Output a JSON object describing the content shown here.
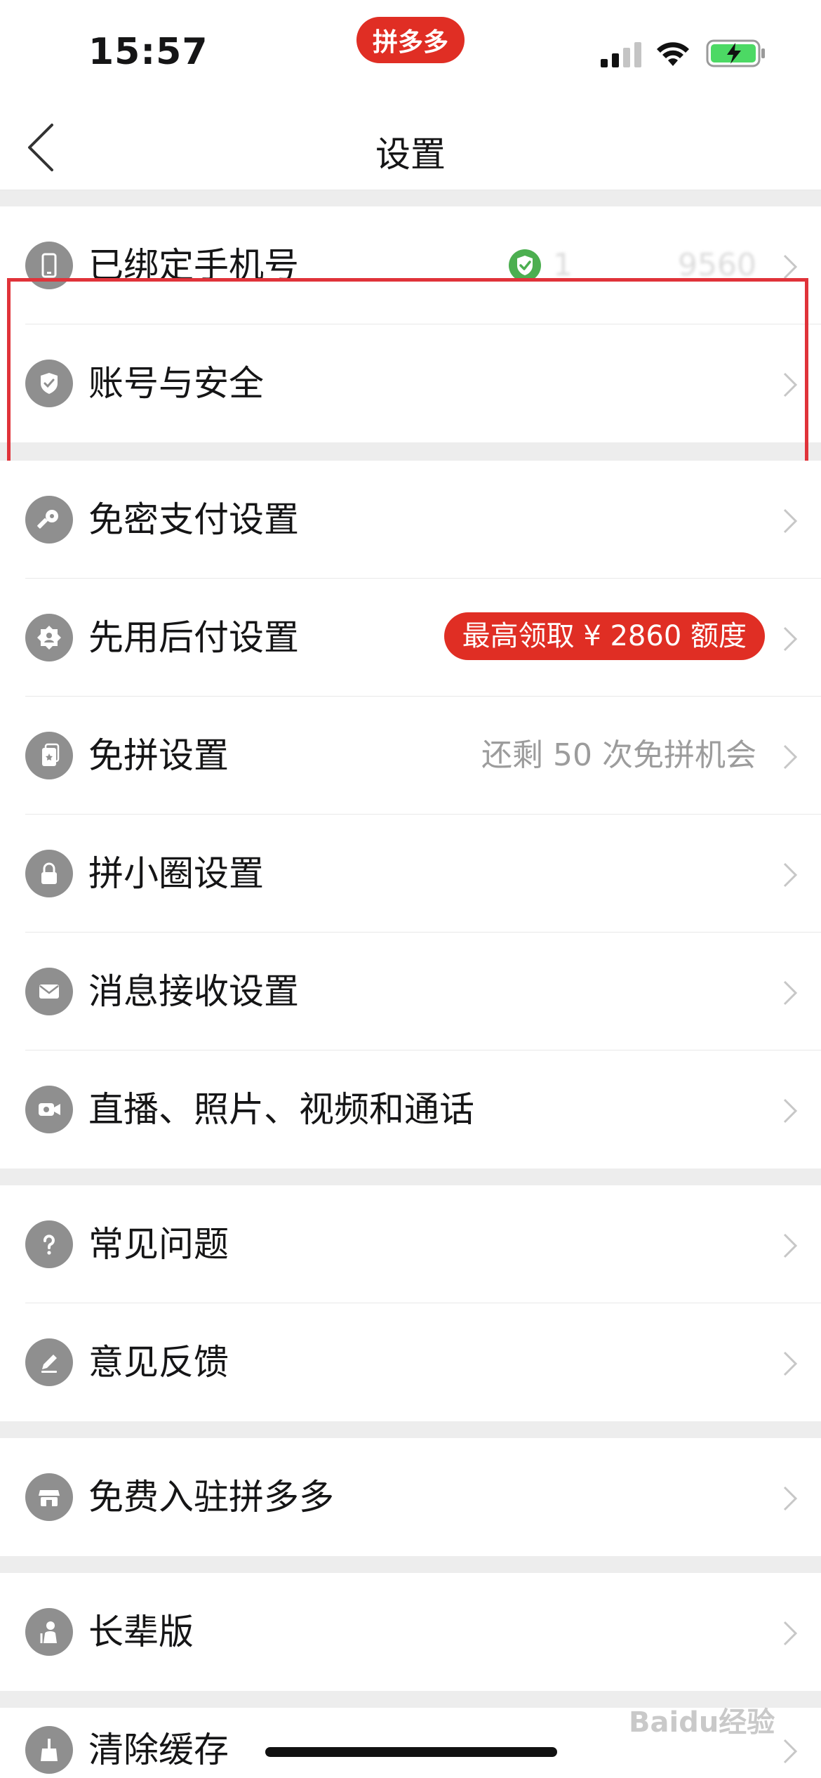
{
  "status_bar": {
    "time": "15:57",
    "app_badge": "拼多多"
  },
  "nav": {
    "title": "设置"
  },
  "phone_row": {
    "label": "已绑定手机号",
    "masked_phone_start": "1",
    "masked_phone_end": "9560"
  },
  "account_row": {
    "label": "账号与安全"
  },
  "settings_group": [
    {
      "label": "免密支付设置"
    },
    {
      "label": "先用后付设置",
      "promo": "最高领取 ¥ 2860 额度"
    },
    {
      "label": "免拼设置",
      "right_text": "还剩 50 次免拼机会"
    },
    {
      "label": "拼小圈设置"
    },
    {
      "label": "消息接收设置"
    },
    {
      "label": "直播、照片、视频和通话"
    }
  ],
  "help_group": [
    {
      "label": "常见问题"
    },
    {
      "label": "意见反馈"
    }
  ],
  "merchant_row": {
    "label": "免费入驻拼多多"
  },
  "elder_row": {
    "label": "长辈版"
  },
  "cache_row": {
    "label": "清除缓存"
  },
  "watermark": "Baidu经验",
  "colors": {
    "accent": "#e02e24",
    "highlight": "#e0333a",
    "verified": "#4caf50",
    "icon_gray": "#8f8f8f"
  }
}
